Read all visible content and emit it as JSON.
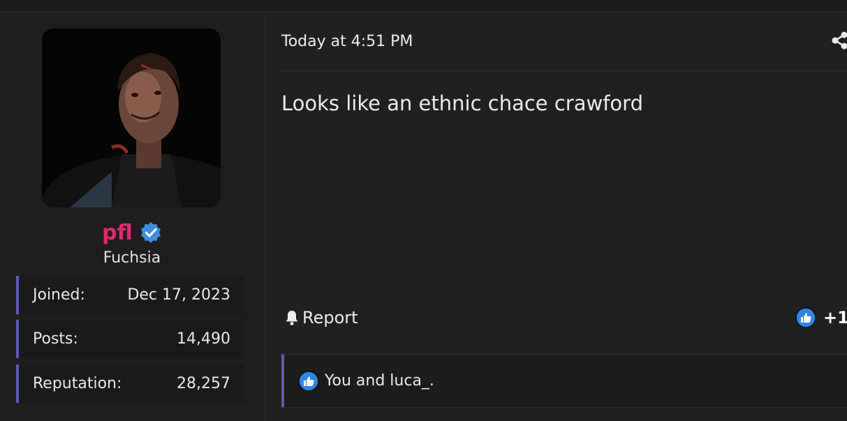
{
  "user": {
    "username": "pfl",
    "title": "Fuchsia",
    "stats": [
      {
        "label": "Joined:",
        "value": "Dec 17, 2023"
      },
      {
        "label": "Posts:",
        "value": "14,490"
      },
      {
        "label": "Reputation:",
        "value": "28,257"
      }
    ]
  },
  "post": {
    "date": "Today at 4:51 PM",
    "message": "Looks like an ethnic chace crawford",
    "report_label": "Report",
    "reaction_count": "+1",
    "likes_text": "You and luca_."
  },
  "colors": {
    "background": "#202020",
    "sidebar": "#1e1e1e",
    "username": "#e5276f",
    "accent_border": "#5a5bb5",
    "like_blue": "#2f86e8",
    "verified_blue": "#3b8fe6"
  },
  "icons": [
    "share-icon",
    "verified-badge-icon",
    "bell-icon",
    "thumbs-up-icon"
  ]
}
